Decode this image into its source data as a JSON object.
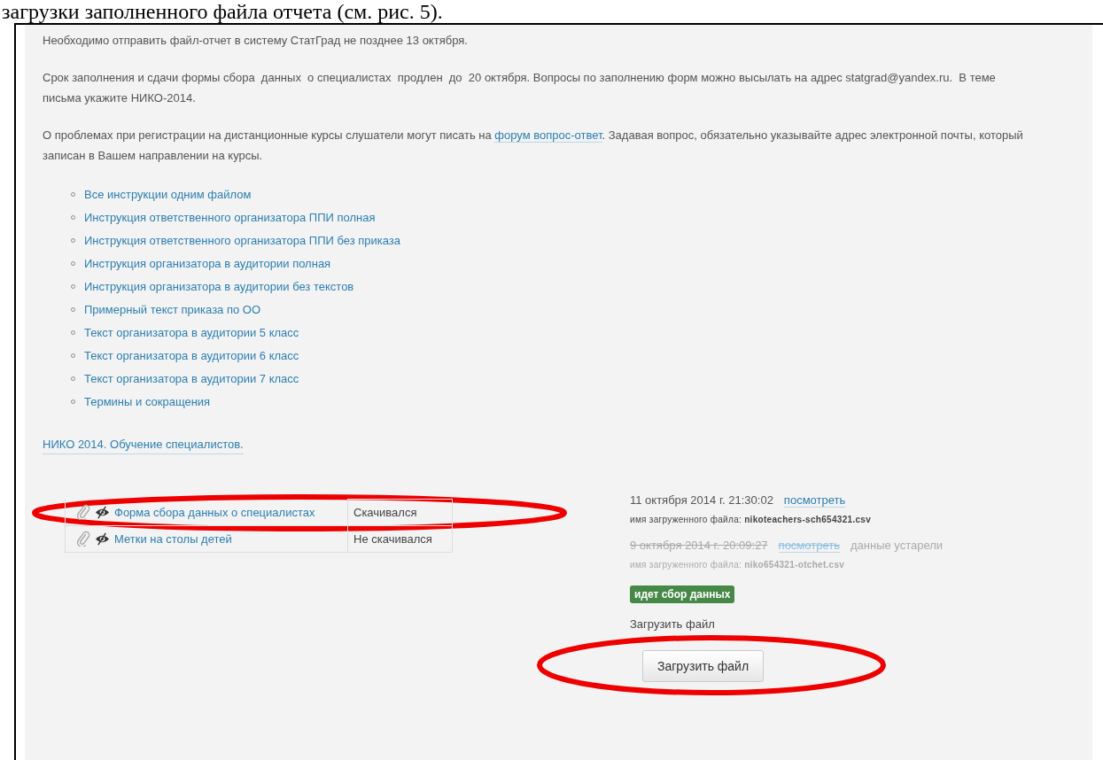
{
  "doc_caption": "загрузки заполненного файла отчета (см. рис. 5).",
  "notices": [
    {
      "before": "Необходимо отправить файл-отчет в систему СтатГрад не позднее 13 октября."
    },
    {
      "before": "Срок заполнения и сдачи формы сбора  данных  о специалистах  продлен  до  20 октября. Вопросы по заполнению форм можно высылать на адрес statgrad@yandex.ru.  В теме письма укажите НИКО-2014."
    },
    {
      "before": "О проблемах при регистрации на дистанционные курсы слушатели могут писать на ",
      "link": "форум вопрос-ответ",
      "after": ". Задавая вопрос, обязательно указывайте адрес электронной почты, который записан в Вашем направлении на курсы."
    }
  ],
  "links": [
    "Все инструкции одним файлом",
    "Инструкция ответственного организатора ППИ полная",
    "Инструкция ответственного организатора ППИ без приказа",
    "Инструкция организатора в аудитории полная",
    "Инструкция организатора в аудитории без текстов",
    "Примерный текст приказа по ОО",
    "Текст организатора в аудитории 5 класс",
    "Текст организатора в аудитории 6 класс",
    "Текст организатора в аудитории 7 класс",
    "Термины и сокращения"
  ],
  "course_link": "НИКО 2014. Обучение специалистов.",
  "files": [
    {
      "name": "Форма сбора данных о специалистах",
      "status": "Скачивался"
    },
    {
      "name": "Метки на столы детей",
      "status": "Не скачивался"
    }
  ],
  "uploads": [
    {
      "date": "11 октября 2014 г. 21:30:02",
      "link": "посмотреть",
      "file_label": "имя загруженного файла:",
      "file_name": "nikoteachers-sch654321.csv",
      "outdated": false
    },
    {
      "date": "9 октября 2014 г. 20:09:27",
      "link": "посмотреть",
      "note": "данные устарели",
      "file_label": "имя загруженного файла:",
      "file_name": "niko654321-otchet.csv",
      "outdated": true
    }
  ],
  "status_badge": "идет сбор данных",
  "upload_label": "Загрузить файл",
  "upload_button": "Загрузить файл"
}
